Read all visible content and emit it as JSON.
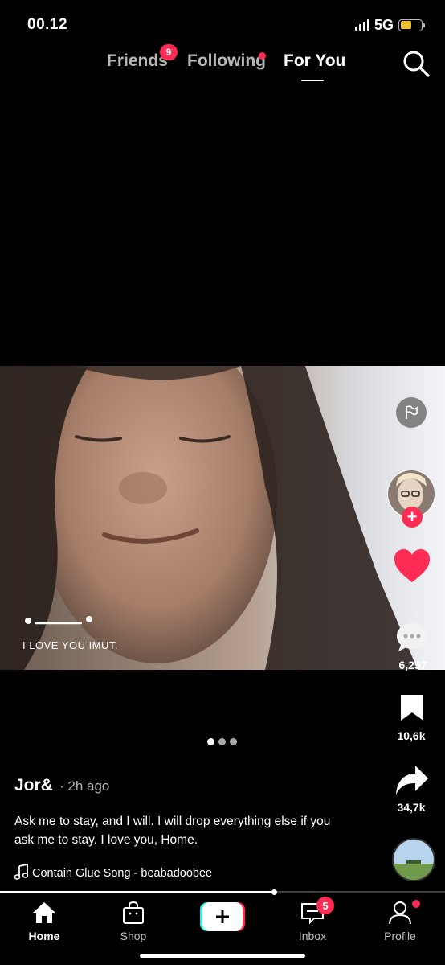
{
  "status_bar": {
    "time": "00.12",
    "network": "5G",
    "battery_level": 0.55,
    "battery_color": "#f0c22e"
  },
  "top_tabs": {
    "items": [
      {
        "label": "Friends",
        "badge": "9",
        "active": false
      },
      {
        "label": "Following",
        "has_dot": true,
        "active": false
      },
      {
        "label": "For You",
        "active": true
      }
    ],
    "search_icon": "search-icon"
  },
  "video": {
    "overlay_text": "I LOVE YOU IMUT.",
    "page_dots": 3,
    "current_page": 1
  },
  "actions": {
    "flag_icon": "flag-icon",
    "likes_icon": "heart-icon",
    "liked": true,
    "comments": "6,257",
    "bookmarks": "10,6k",
    "shares": "34,7k"
  },
  "post": {
    "username": "Jor&",
    "time": "· 2h ago",
    "description": "Ask me to stay, and I will. I will drop everything else if you ask me to stay. I love you, Home.",
    "song": "Contain Glue Song - beabadoobee",
    "progress": 0.615
  },
  "bottom_nav": {
    "items": [
      {
        "label": "Home",
        "icon": "home-icon",
        "active": true
      },
      {
        "label": "Shop",
        "icon": "shop-icon",
        "active": false
      },
      {
        "label": "",
        "icon": "create-icon",
        "active": false
      },
      {
        "label": "Inbox",
        "icon": "inbox-icon",
        "badge": "5",
        "active": false
      },
      {
        "label": "Profile",
        "icon": "profile-icon",
        "has_dot": true,
        "active": false
      }
    ]
  },
  "colors": {
    "accent": "#fe2c55",
    "background": "#000000"
  }
}
